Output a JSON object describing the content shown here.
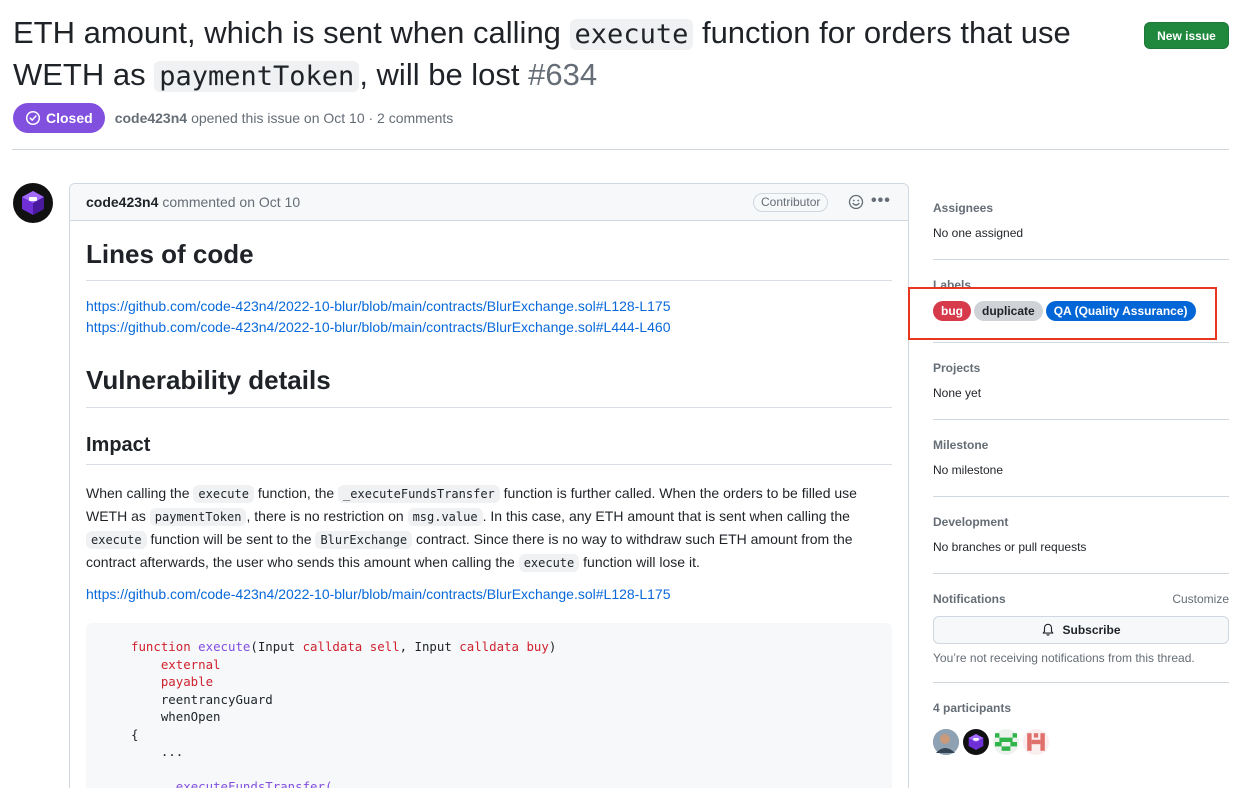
{
  "issue": {
    "title_part1": "ETH amount, which is sent when calling ",
    "title_code1": "execute",
    "title_part2": " function for orders that use WETH as ",
    "title_code2": "paymentToken",
    "title_part3": ", will be lost ",
    "number": "#634",
    "state": "Closed",
    "author": "code423n4",
    "opened_text": "opened this issue on Oct 10 · 2 comments"
  },
  "header": {
    "new_issue_label": "New issue"
  },
  "comment": {
    "author": "code423n4",
    "meta": "commented on Oct 10",
    "role": "Contributor",
    "h_lines": "Lines of code",
    "link1": "https://github.com/code-423n4/2022-10-blur/blob/main/contracts/BlurExchange.sol#L128-L175",
    "link2": "https://github.com/code-423n4/2022-10-blur/blob/main/contracts/BlurExchange.sol#L444-L460",
    "h_vuln": "Vulnerability details",
    "h_impact": "Impact",
    "p1_a": "When calling the ",
    "p1_c1": "execute",
    "p1_b": " function, the ",
    "p1_c2": "_executeFundsTransfer",
    "p1_c": " function is further called. When the orders to be filled use WETH as ",
    "p1_c3": "paymentToken",
    "p1_d": ", there is no restriction on ",
    "p1_c4": "msg.value",
    "p1_e": ". In this case, any ETH amount that is sent when calling the ",
    "p1_c5": "execute",
    "p1_f": " function will be sent to the ",
    "p1_c6": "BlurExchange",
    "p1_g": " contract. Since there is no way to withdraw such ETH amount from the contract afterwards, the user who sends this amount when calling the ",
    "p1_c7": "execute",
    "p1_h": " function will lose it.",
    "link3": "https://github.com/code-423n4/2022-10-blur/blob/main/contracts/BlurExchange.sol#L128-L175",
    "code": {
      "l1_kw": "function",
      "l1_fn": "execute",
      "l1_a": "(Input ",
      "l1_kw2": "calldata",
      "l1_v1": "sell",
      "l1_b": ", Input ",
      "l1_kw3": "calldata",
      "l1_v2": "buy",
      "l1_c": ")",
      "l2": "external",
      "l3": "payable",
      "l4": "reentrancyGuard",
      "l5": "whenOpen",
      "l6": "{",
      "l7": "...",
      "l8": "_executeFundsTransfer("
    }
  },
  "sidebar": {
    "assignees_title": "Assignees",
    "assignees_value": "No one assigned",
    "labels_title": "Labels",
    "labels": [
      {
        "name": "bug",
        "bg": "#d73a4a",
        "fg": "#ffffff"
      },
      {
        "name": "duplicate",
        "bg": "#cfd3d7",
        "fg": "#1f2328"
      },
      {
        "name": "QA (Quality Assurance)",
        "bg": "#0366d6",
        "fg": "#ffffff"
      }
    ],
    "projects_title": "Projects",
    "projects_value": "None yet",
    "milestone_title": "Milestone",
    "milestone_value": "No milestone",
    "development_title": "Development",
    "development_value": "No branches or pull requests",
    "notifications_title": "Notifications",
    "customize_label": "Customize",
    "subscribe_label": "Subscribe",
    "notifications_note": "You’re not receiving notifications from this thread.",
    "participants_title": "4 participants"
  },
  "colors": {
    "closed": "#8250df",
    "new_issue": "#1f883d",
    "link": "#0969da",
    "highlight": "#e8371f"
  }
}
